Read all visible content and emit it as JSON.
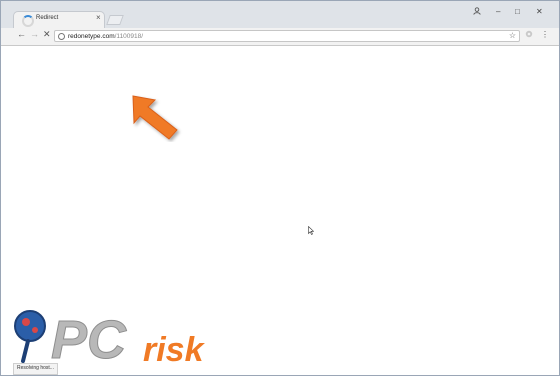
{
  "tab": {
    "title": "Redirect",
    "close": "×"
  },
  "window": {
    "user_icon": "user-icon",
    "minimize": "–",
    "maximize": "□",
    "close": "✕"
  },
  "toolbar": {
    "back": "←",
    "forward": "→",
    "stop": "✕",
    "menu": "⋮",
    "star": "☆"
  },
  "address": {
    "domain": "redonetype.com",
    "path": "/1100918/"
  },
  "status_bar": {
    "text": "Resolving host..."
  },
  "watermark": {
    "text": "PCrisk"
  },
  "colors": {
    "arrow": "#f07a25",
    "watermark_blue": "#2b5ea8",
    "watermark_gray": "#b8b8b8",
    "watermark_orange": "#f07a25"
  }
}
